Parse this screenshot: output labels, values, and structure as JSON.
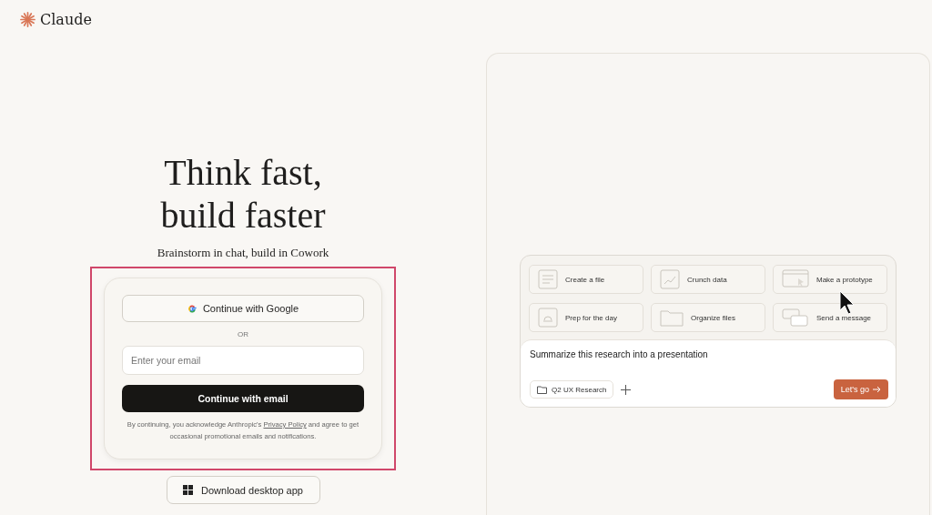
{
  "logo": {
    "name": "Claude"
  },
  "hero": {
    "title_lines": [
      "Think fast,",
      "build faster"
    ],
    "subtitle": "Brainstorm in chat, build in Cowork"
  },
  "login": {
    "google_button": "Continue with Google",
    "divider": "OR",
    "email_field": {
      "placeholder": "Enter your email"
    },
    "email_button": "Continue with email",
    "legal": "By continuing, you acknowledge Anthropic's ",
    "legal_link": "Privacy Policy",
    "legal_end": " and agree to get occasional promotional emails and notifications."
  },
  "download_button": "Download desktop app",
  "preview": {
    "suggestions": [
      {
        "label": "Create a file",
        "kind": "file"
      },
      {
        "label": "Crunch data",
        "kind": "chart"
      },
      {
        "label": "Make a prototype",
        "kind": "window"
      },
      {
        "label": "Prep for the day",
        "kind": "bell"
      },
      {
        "label": "Organize files",
        "kind": "folder"
      },
      {
        "label": "Send a message",
        "kind": "message"
      }
    ],
    "prompt": "Summarize this research into a presentation",
    "project": "Q2 UX Research",
    "submit": "Let's go"
  }
}
